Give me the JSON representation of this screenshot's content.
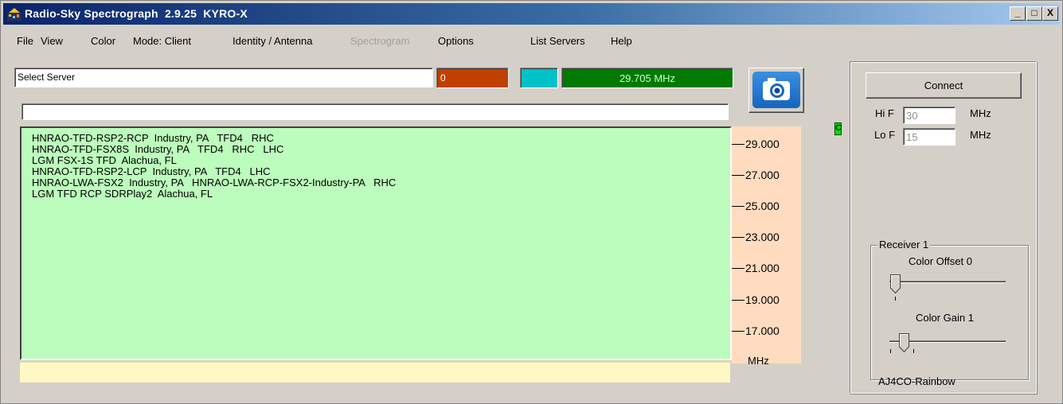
{
  "window": {
    "title": "Radio-Sky Spectrograph  2.9.25  KYRO-X",
    "minimize": "_",
    "maximize": "□",
    "close": "X"
  },
  "menu": [
    {
      "label": "File",
      "disabled": false
    },
    {
      "label": "View",
      "disabled": false
    },
    {
      "label": "Color",
      "disabled": false
    },
    {
      "label": "Mode: Client",
      "disabled": false
    },
    {
      "label": "Identity / Antenna",
      "disabled": false
    },
    {
      "label": "Spectrogram",
      "disabled": true
    },
    {
      "label": "Options",
      "disabled": false
    },
    {
      "label": "List Servers",
      "disabled": false
    },
    {
      "label": "Help",
      "disabled": false
    }
  ],
  "toolbar": {
    "server_select": "Select Server",
    "counter": "0",
    "frequency": "29.705 MHz",
    "status": ""
  },
  "server_list": [
    "HNRAO-TFD-RSP2-RCP  Industry, PA   TFD4   RHC",
    "HNRAO-TFD-FSX8S  Industry, PA   TFD4   RHC   LHC",
    "LGM FSX-1S TFD  Alachua, FL",
    "HNRAO-TFD-RSP2-LCP  Industry, PA   TFD4   LHC",
    "HNRAO-LWA-FSX2  Industry, PA   HNRAO-LWA-RCP-FSX2-Industry-PA   RHC",
    "LGM TFD RCP SDRPlay2  Alachua, FL"
  ],
  "scale": {
    "ticks": [
      "29.000",
      "27.000",
      "25.000",
      "23.000",
      "21.000",
      "19.000",
      "17.000"
    ],
    "unit": "MHz"
  },
  "indicator": "C",
  "right_panel": {
    "connect_label": "Connect",
    "hi_f_label": "Hi F",
    "hi_f_value": "30",
    "lo_f_label": "Lo F",
    "lo_f_value": "15",
    "unit": "MHz",
    "receiver_group": "Receiver 1",
    "color_offset_label": "Color Offset 0",
    "color_gain_label": "Color Gain 1",
    "palette": "AJ4CO-Rainbow"
  },
  "colors": {
    "list_bg": "#bcfcbc",
    "scale_bg": "#ffdcc0",
    "freq_bg": "#007a00",
    "counter_bg": "#c04000",
    "cyan": "#00c0c8"
  },
  "icons": [
    "app-icon",
    "camera-icon"
  ]
}
